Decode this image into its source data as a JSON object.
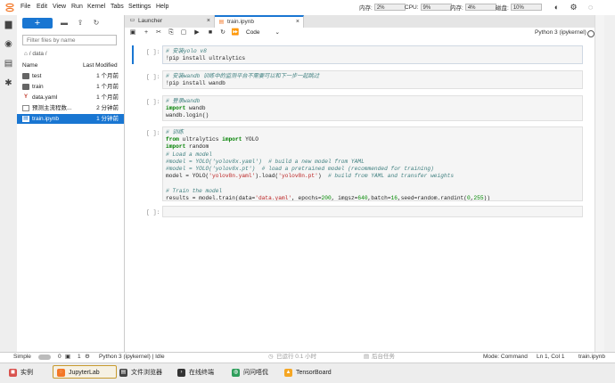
{
  "menubar": {
    "items": [
      "File",
      "Edit",
      "View",
      "Run",
      "Kernel",
      "Tabs",
      "Settings",
      "Help"
    ],
    "meters": [
      {
        "label": "内存:",
        "value": "2%"
      },
      {
        "label": "CPU:",
        "value": "9%"
      },
      {
        "label": "内存:",
        "value": "4%"
      },
      {
        "label": "磁盘:",
        "value": "10%"
      }
    ]
  },
  "filebrowser": {
    "filter_placeholder": "Filter files by name",
    "breadcrumb": "/ data /",
    "col_name": "Name",
    "col_modified": "Last Modified",
    "files": [
      {
        "name": "test",
        "modified": "1 个月前",
        "type": "folder"
      },
      {
        "name": "train",
        "modified": "1 个月前",
        "type": "folder"
      },
      {
        "name": "data.yaml",
        "modified": "1 个月前",
        "type": "yaml"
      },
      {
        "name": "预测主流程数...",
        "modified": "2 分钟前",
        "type": "file"
      },
      {
        "name": "train.ipynb",
        "modified": "1 分钟前",
        "type": "notebook",
        "selected": true
      }
    ]
  },
  "tabs": [
    {
      "label": "Launcher",
      "active": false
    },
    {
      "label": "train.ipynb",
      "active": true
    }
  ],
  "toolbar": {
    "cell_type": "Code",
    "kernel": "Python 3 (ipykernel)"
  },
  "cells": [
    {
      "prompt": "[ ]:"
    },
    {
      "prompt": "[ ]:"
    },
    {
      "prompt": "[ ]:"
    },
    {
      "prompt": "[ ]:"
    },
    {
      "prompt": "[ ]:"
    }
  ],
  "code": {
    "c1_l1": "# 安装yolo v8",
    "c1_l2": "!pip install ultralytics",
    "c2_l1": "# 安装wandb 训练中的监测平台不需要可以和下一步一起跳过",
    "c2_l2": "!pip install wandb",
    "c3_l1": "# 登录wandb",
    "c3_l2_kw": "import",
    "c3_l2": " wandb",
    "c3_l3": "wandb.login()",
    "c4_l1": "# 训练",
    "c4_l2_kw1": "from",
    "c4_l2_a": " ultralytics ",
    "c4_l2_kw2": "import",
    "c4_l2_b": " YOLO",
    "c4_l3_kw": "import",
    "c4_l3": " random",
    "c4_l4": "# Load a model",
    "c4_l5": "#model = YOLO('yolov8x.yaml')  # build a new model from YAML",
    "c4_l6": "#model = YOLO('yolov8x.pt')  # load a pretrained model (recommended for training)",
    "c4_l7_a": "model = YOLO(",
    "c4_l7_s1": "'yolov8n.yaml'",
    "c4_l7_b": ").load(",
    "c4_l7_s2": "'yolov8n.pt'",
    "c4_l7_c": ")  ",
    "c4_l7_cm": "# build from YAML and transfer weights",
    "c4_l9": "# Train the model",
    "c4_l10_a": "results = model.train(data=",
    "c4_l10_s": "'data.yaml'",
    "c4_l10_b": ", epochs=",
    "c4_l10_n1": "200",
    "c4_l10_c": ", imgsz=",
    "c4_l10_n2": "640",
    "c4_l10_d": ",batch=",
    "c4_l10_n3": "16",
    "c4_l10_e": ",seed=random.randint(",
    "c4_l10_n4": "0",
    "c4_l10_f": ",",
    "c4_l10_n5": "255",
    "c4_l10_g": "))"
  },
  "statusbar": {
    "simple": "Simple",
    "count_a": "0",
    "count_b": "1",
    "kernel_status": "Python 3 (ipykernel) | Idle",
    "runtime": "已运行 0.1 小时",
    "background": "后台任务",
    "mode": "Mode: Command",
    "position": "Ln 1, Col 1",
    "filename": "train.ipynb"
  },
  "taskbar": [
    {
      "label": "实例",
      "color": "#d9534f",
      "active": false
    },
    {
      "label": "JupyterLab",
      "color": "#f37726",
      "active": true
    },
    {
      "label": "文件浏览器",
      "color": "#444444",
      "active": false
    },
    {
      "label": "在线终端",
      "color": "#333333",
      "active": false
    },
    {
      "label": "问问唔侃",
      "color": "#2e9e5b",
      "active": false
    },
    {
      "label": "TensorBoard",
      "color": "#f5a623",
      "active": false
    }
  ]
}
